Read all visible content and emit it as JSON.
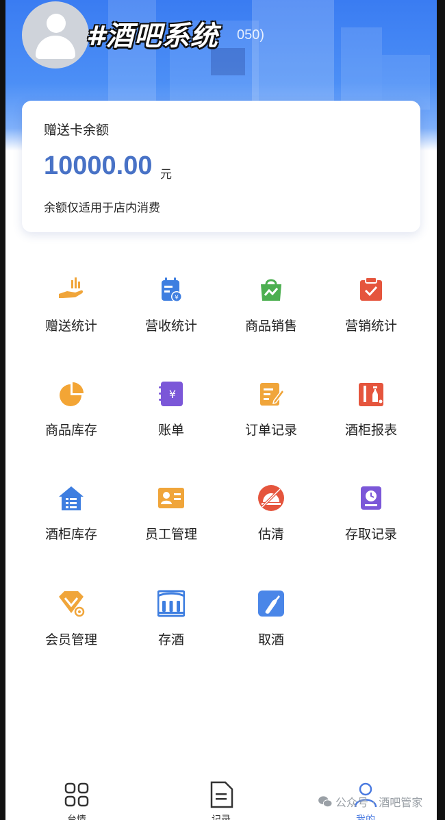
{
  "header": {
    "title": "#酒吧系统",
    "phone_suffix": "050)"
  },
  "balance_card": {
    "label": "赠送卡余额",
    "amount": "10000.00",
    "unit": "元",
    "note": "余额仅适用于店内消费"
  },
  "menu": [
    {
      "label": "赠送统计",
      "icon": "hand-bars-icon",
      "color": "#f0a53a"
    },
    {
      "label": "营收统计",
      "icon": "calendar-yen-icon",
      "color": "#3e7ee0"
    },
    {
      "label": "商品销售",
      "icon": "shopping-bag-icon",
      "color": "#4caf50"
    },
    {
      "label": "营销统计",
      "icon": "clipboard-check-icon",
      "color": "#e5553d"
    },
    {
      "label": "商品库存",
      "icon": "pie-chart-icon",
      "color": "#f3a535"
    },
    {
      "label": "账单",
      "icon": "yen-notebook-icon",
      "color": "#7b57d8"
    },
    {
      "label": "订单记录",
      "icon": "notepad-pencil-icon",
      "color": "#f0a53a"
    },
    {
      "label": "酒柜报表",
      "icon": "wine-cabinet-icon",
      "color": "#e5553d"
    },
    {
      "label": "酒柜库存",
      "icon": "house-list-icon",
      "color": "#3e7ee0"
    },
    {
      "label": "员工管理",
      "icon": "id-card-icon",
      "color": "#f0a53a"
    },
    {
      "label": "估清",
      "icon": "no-dish-icon",
      "color": "#e5553d"
    },
    {
      "label": "存取记录",
      "icon": "clock-card-icon",
      "color": "#7b57d8"
    },
    {
      "label": "会员管理",
      "icon": "diamond-badge-icon",
      "color": "#f0a53a"
    },
    {
      "label": "存酒",
      "icon": "bottle-rack-icon",
      "color": "#3e7ee0"
    },
    {
      "label": "取酒",
      "icon": "bottle-out-icon",
      "color": "#3e7ee0"
    }
  ],
  "tabbar": {
    "tabs": [
      {
        "label": "台情",
        "icon": "grid-icon"
      },
      {
        "label": "记录",
        "icon": "document-icon"
      },
      {
        "label": "我的",
        "icon": "user-icon",
        "active": true
      }
    ],
    "accent": "#4a7ae0"
  },
  "watermark": "公众号 · 酒吧管家"
}
